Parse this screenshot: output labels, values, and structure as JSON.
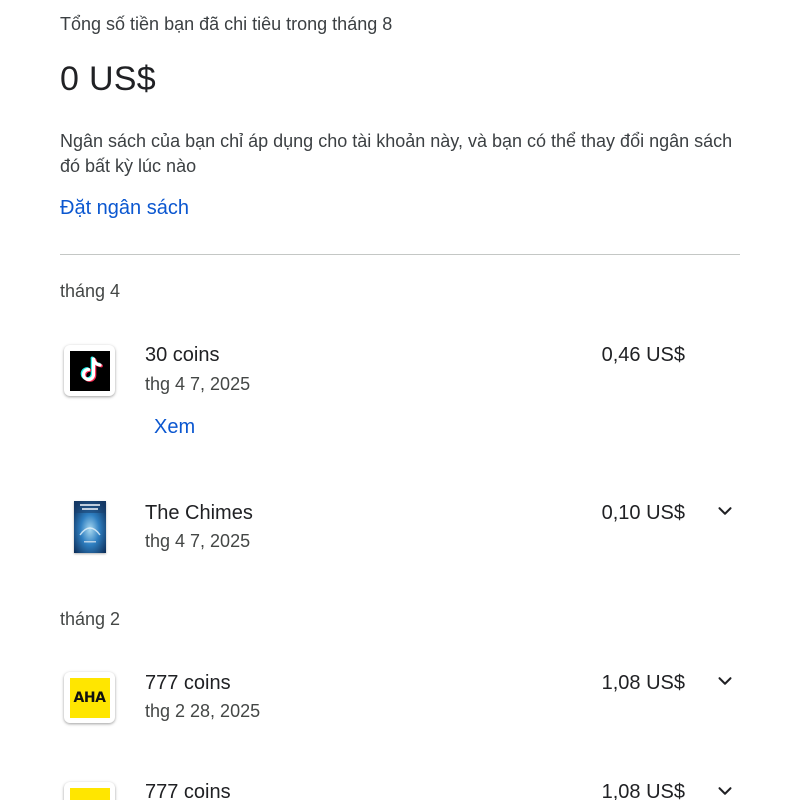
{
  "summary": {
    "label": "Tổng số tiền bạn đã chi tiêu trong tháng 8",
    "total": "0 US$",
    "budget_note": "Ngân sách của bạn chỉ áp dụng cho tài khoản này, và bạn có thể thay đổi ngân sách đó bất kỳ lúc nào",
    "set_budget_label": "Đặt ngân sách"
  },
  "months": [
    {
      "heading": "tháng 4",
      "items": [
        {
          "title": "30 coins",
          "date": "thg 4 7, 2025",
          "price": "0,46 US$",
          "action_label": "Xem",
          "icon": "tiktok-logo-icon"
        },
        {
          "title": "The Chimes",
          "date": "thg 4 7, 2025",
          "price": "0,10 US$",
          "icon": "book-cover-icon"
        }
      ]
    },
    {
      "heading": "tháng 2",
      "items": [
        {
          "title": "777 coins",
          "date": "thg 2 28, 2025",
          "price": "1,08 US$",
          "icon": "aha-logo-icon",
          "logo_text": "AHA"
        },
        {
          "title": "777 coins",
          "price": "1,08 US$",
          "icon": "aha-logo-icon"
        }
      ]
    }
  ],
  "colors": {
    "link": "#0b57d0",
    "text": "#202124",
    "secondary_text": "#444746",
    "divider": "#c4c7c5",
    "aha_yellow": "#ffe600"
  }
}
